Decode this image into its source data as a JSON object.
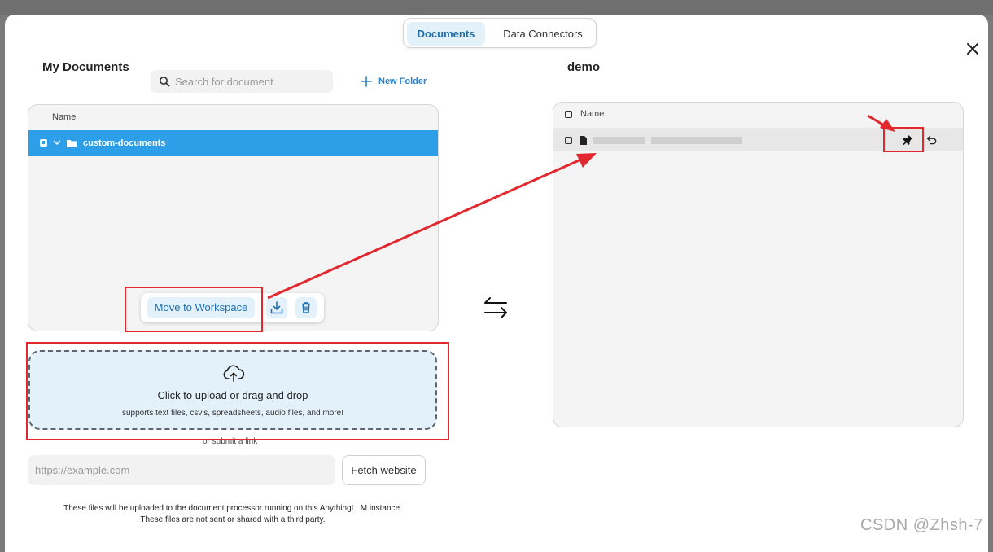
{
  "tabs": [
    {
      "label": "Documents",
      "active": true
    },
    {
      "label": "Data Connectors",
      "active": false
    }
  ],
  "left": {
    "title": "My Documents",
    "search_placeholder": "Search for document",
    "new_folder_label": "New Folder",
    "column_name": "Name",
    "folder_name": "custom-documents",
    "move_label": "Move to Workspace",
    "upload_title": "Click to upload or drag and drop",
    "upload_sub": "supports text files, csv's, spreadsheets, audio files, and more!",
    "or_link": "or submit a link",
    "url_placeholder": "https://example.com",
    "fetch_label": "Fetch website",
    "note_line1": "These files will be uploaded to the document processor running on this AnythingLLM instance.",
    "note_line2": "These files are not sent or shared with a third party."
  },
  "right": {
    "title": "demo",
    "column_name": "Name"
  },
  "watermark": "CSDN @Zhsh-7",
  "colors": {
    "accent": "#2c9fe8",
    "accent_light": "#e3f1fb",
    "annotation_red": "#e0282e"
  },
  "icons": [
    "search-icon",
    "plus-icon",
    "folder-icon",
    "chevron-down-icon",
    "upload-cloud-icon",
    "download-tray-icon",
    "trash-icon",
    "swap-arrows-icon",
    "file-icon",
    "pin-icon",
    "undo-icon",
    "close-icon"
  ]
}
